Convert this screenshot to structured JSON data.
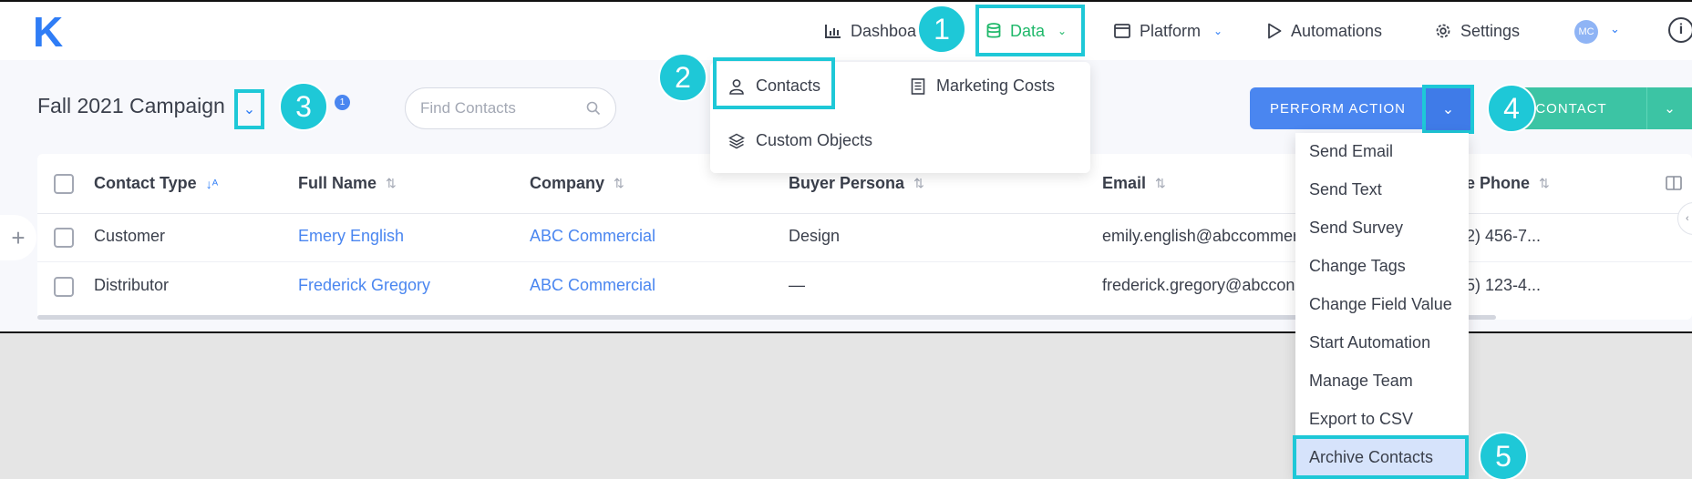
{
  "app": {
    "logo": "K"
  },
  "nav": {
    "dashboard": "Dashboa",
    "data": "Data",
    "platform": "Platform",
    "automations": "Automations",
    "settings": "Settings",
    "avatar_initials": "MC",
    "info_glyph": "i"
  },
  "header": {
    "title": "Fall 2021 Campaign",
    "notification_count": "1",
    "search_placeholder": "Find Contacts",
    "perform_action": "PERFORM ACTION",
    "new_contact": "W CONTACT"
  },
  "data_menu": {
    "contacts": "Contacts",
    "marketing_costs": "Marketing Costs",
    "custom_objects": "Custom Objects"
  },
  "table": {
    "columns": [
      "Contact Type",
      "Full Name",
      "Company",
      "Buyer Persona",
      "Email",
      "ile Phone"
    ],
    "rows": [
      {
        "type": "Customer",
        "name": "Emery English",
        "company": "ABC Commercial",
        "persona": "Design",
        "email": "emily.english@abccommer",
        "phone": "12) 456-7..."
      },
      {
        "type": "Distributor",
        "name": "Frederick Gregory",
        "company": "ABC Commercial",
        "persona": "—",
        "email": "frederick.gregory@abccon",
        "phone": "55) 123-4..."
      }
    ]
  },
  "action_menu": {
    "items": [
      "Send Email",
      "Send Text",
      "Send Survey",
      "Change Tags",
      "Change Field Value",
      "Start Automation",
      "Manage Team",
      "Export to CSV",
      "Archive Contacts"
    ]
  },
  "callouts": [
    "1",
    "2",
    "3",
    "4",
    "5"
  ],
  "colors": {
    "accent": "#2f7df6",
    "data_green": "#1fb86a",
    "callout": "#1ec8d7",
    "primary_button": "#4a86f0",
    "new_contact_button": "#3cc4a4"
  }
}
